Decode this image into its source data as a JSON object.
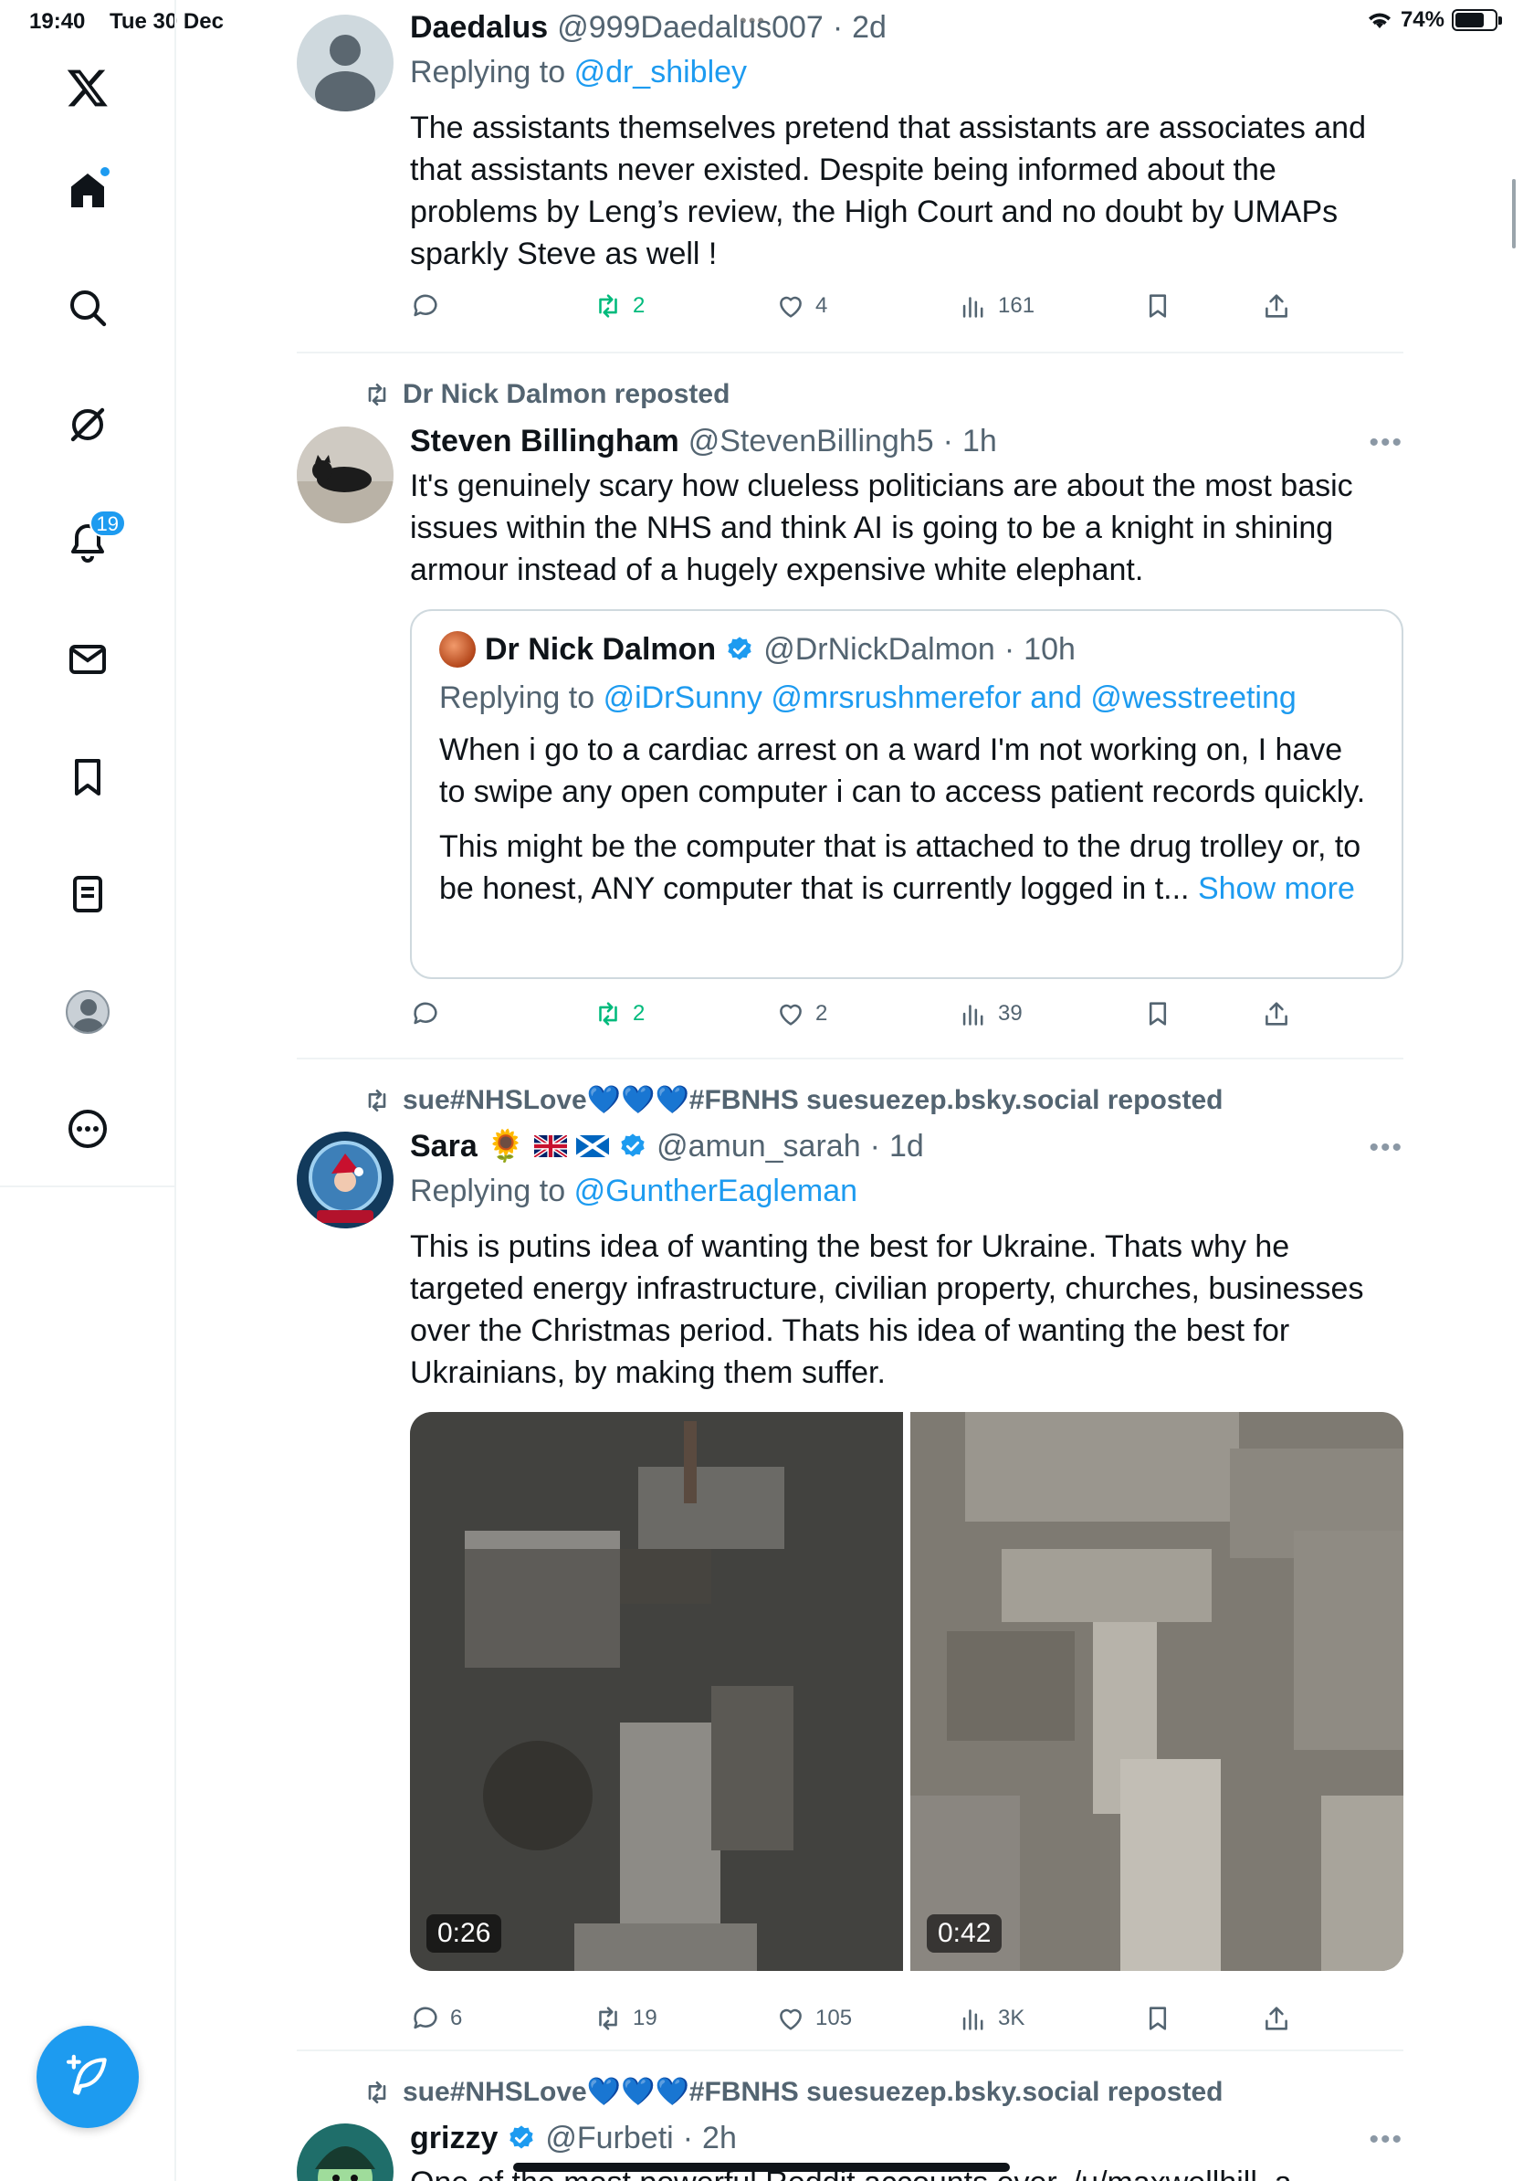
{
  "status": {
    "time": "19:40",
    "date": "Tue 30 Dec",
    "battery": "74%",
    "battery_level": 0.74
  },
  "sidebar": {
    "notifications_badge": "19",
    "items": [
      "X",
      "Home",
      "Explore",
      "Grok",
      "Notifications",
      "Messages",
      "Bookmarks",
      "Lists",
      "Profile",
      "More"
    ]
  },
  "feed": {
    "posts": [
      {
        "name": "Daedalus",
        "handle": "@999Daedalus007",
        "time": "2d",
        "reply_prefix": "Replying to",
        "reply_to": "@dr_shibley",
        "text": "The assistants themselves pretend that assistants are associates and that assistants never existed. Despite being informed about the problems by Leng’s review, the High Court and no doubt by UMAPs sparkly Steve as well !",
        "replies": "",
        "reposts": "2",
        "likes": "4",
        "views": "161"
      },
      {
        "reposted_by": "Dr Nick Dalmon reposted",
        "name": "Steven Billingham",
        "handle": "@StevenBillingh5",
        "time": "1h",
        "text": "It's genuinely scary how clueless politicians are about the most basic issues within the NHS and think AI is going to be a knight in shining armour instead of a hugely expensive white elephant.",
        "quote": {
          "name": "Dr Nick Dalmon",
          "handle": "@DrNickDalmon",
          "time": "10h",
          "reply_prefix": "Replying to",
          "reply_to": "@iDrSunny @mrsrushmerefor and @wesstreeting",
          "text_1": "When i go to a cardiac arrest on a ward I'm not working on, I have to swipe any open computer i can to access patient records quickly.",
          "text_2": "This might be the computer that is attached to the drug trolley or, to be honest, ANY computer that is currently logged in t...",
          "show_more": "Show more"
        },
        "replies": "",
        "reposts": "2",
        "likes": "2",
        "views": "39"
      },
      {
        "reposted_by": "sue#NHSLove💙💙💙#FBNHS suesuezep.bsky.social reposted",
        "name": "Sara",
        "emoji": "🌻",
        "handle": "@amun_sarah",
        "time": "1d",
        "reply_prefix": "Replying to",
        "reply_to": "@GuntherEagleman",
        "text": "This is putins idea of wanting the best for Ukraine. Thats why he targeted energy infrastructure, civilian property, churches, businesses over the Christmas period. Thats his idea of wanting the best for Ukrainians, by making them suffer.",
        "video_1_duration": "0:26",
        "video_2_duration": "0:42",
        "replies": "6",
        "reposts": "19",
        "likes": "105",
        "views": "3K"
      },
      {
        "reposted_by": "sue#NHSLove💙💙💙#FBNHS suesuezep.bsky.social reposted",
        "name": "grizzy",
        "handle": "@Furbeti",
        "time": "2h",
        "text": "One of the most powerful Reddit accounts ever, /u/maxwellhill, a"
      }
    ]
  },
  "colors": {
    "accent": "#1d9bf0",
    "repost_green": "#00ba7c",
    "secondary_text": "#536471"
  }
}
